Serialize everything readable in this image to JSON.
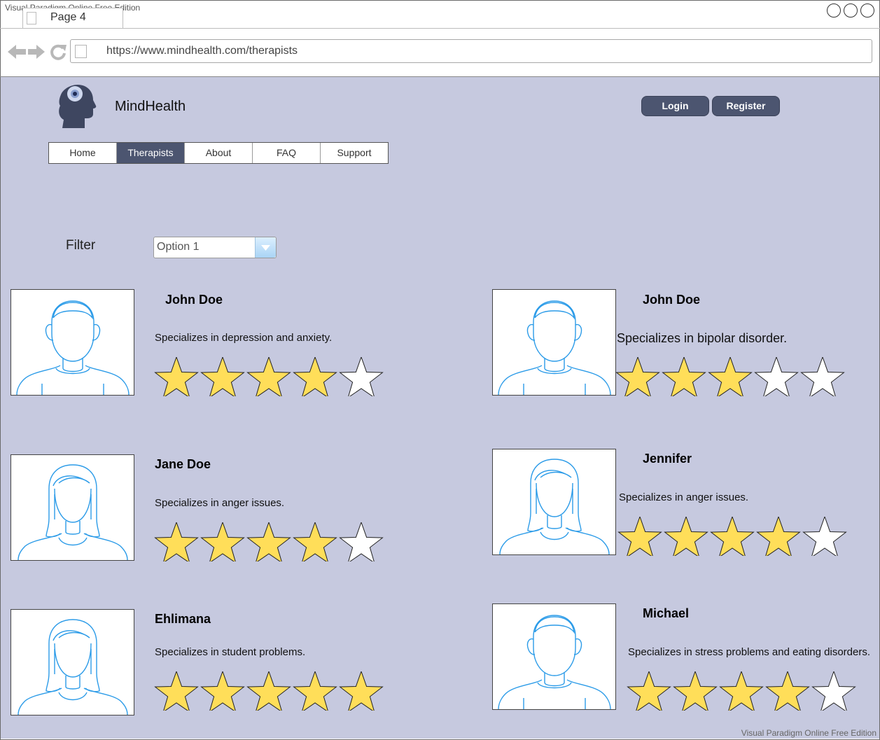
{
  "window": {
    "watermark_top": "Visual Paradigm Online Free Edition",
    "watermark_bottom": "Visual Paradigm Online Free Edition",
    "tab_label": "Page 4"
  },
  "browser": {
    "url": "https://www.mindhealth.com/therapists"
  },
  "site": {
    "brand": "MindHealth",
    "login_label": "Login",
    "register_label": "Register"
  },
  "nav": {
    "items": [
      {
        "label": "Home"
      },
      {
        "label": "Therapists",
        "active": true
      },
      {
        "label": "About"
      },
      {
        "label": "FAQ"
      },
      {
        "label": "Support"
      }
    ]
  },
  "filter": {
    "label": "Filter",
    "selected": "Option 1"
  },
  "therapists": [
    {
      "name": "John Doe",
      "specialty": "Specializes in depression and anxiety.",
      "rating": 4,
      "gender": "male"
    },
    {
      "name": "John Doe",
      "specialty": "Specializes in bipolar disorder.",
      "rating": 3,
      "gender": "male"
    },
    {
      "name": "Jane Doe",
      "specialty": "Specializes in anger issues.",
      "rating": 4,
      "gender": "female"
    },
    {
      "name": "Jennifer",
      "specialty": "Specializes in anger issues.",
      "rating": 4,
      "gender": "female"
    },
    {
      "name": "Ehlimana",
      "specialty": "Specializes in student problems.",
      "rating": 5,
      "gender": "female"
    },
    {
      "name": "Michael",
      "specialty": "Specializes in stress problems and eating disorders.",
      "rating": 4,
      "gender": "male"
    }
  ],
  "colors": {
    "page_bg": "#c6c9df",
    "accent": "#4c5570",
    "star_fill": "#ffde59",
    "avatar_line": "#2b9be8"
  },
  "icons": {
    "logo": "head-brain-logo",
    "star": "star-icon",
    "avatar": "user-avatar-icon",
    "dropdown": "chevron-down-icon"
  }
}
